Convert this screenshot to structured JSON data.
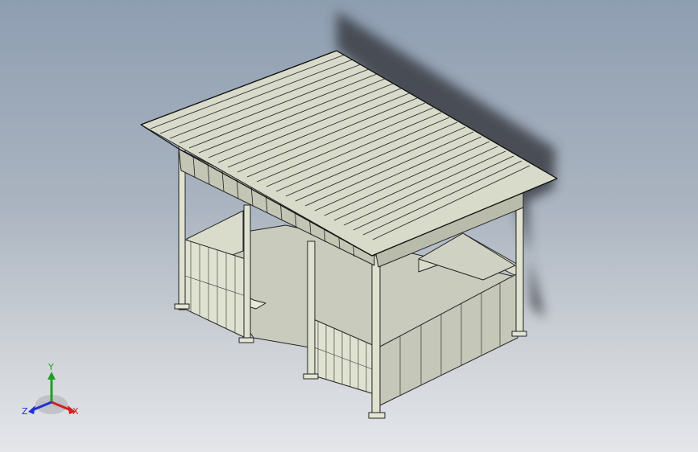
{
  "viewport": {
    "model_name": "gazebo-pavilion-assembly"
  },
  "triad": {
    "x_label": "X",
    "y_label": "Y",
    "z_label": "Z",
    "x_color": "#d02020",
    "y_color": "#20a020",
    "z_color": "#2030d0"
  },
  "colors": {
    "background_top": "#8e9eb1",
    "background_bottom": "#e4e6ea",
    "model_fill": "#d6d9c8",
    "model_dark": "#b8bbaa",
    "edge": "#222222",
    "shadow": "#3a3e44"
  }
}
